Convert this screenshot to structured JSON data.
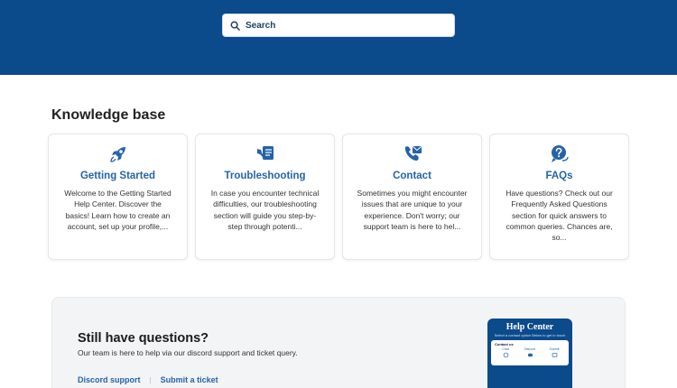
{
  "search": {
    "placeholder": "Search"
  },
  "knowledge_base": {
    "title": "Knowledge base",
    "cards": [
      {
        "icon": "rocket-icon",
        "title": "Getting Started",
        "description": "Welcome to the Getting Started Help Center. Discover the basics! Learn how to create an account, set up your profile,..."
      },
      {
        "icon": "tools-icon",
        "title": "Troubleshooting",
        "description": "In case you encounter technical difficulties, our troubleshooting section will guide you step-by-step through potenti..."
      },
      {
        "icon": "phone-mail-icon",
        "title": "Contact",
        "description": "Sometimes you might encounter issues that are unique to your experience. Don't worry; our support team is here to hel..."
      },
      {
        "icon": "question-chat-icon",
        "title": "FAQs",
        "description": "Have questions? Check out our Frequently Asked Questions section for quick answers to common queries. Chances are, so..."
      }
    ]
  },
  "cta": {
    "heading": "Still have questions?",
    "subtext": "Our team is here to help via our discord support and ticket query.",
    "link_discord": "Discord support",
    "separator": "|",
    "link_ticket": "Submit a ticket",
    "preview": {
      "title": "Help Center",
      "subtitle": "Select a contact option Below to get in touch",
      "panel_heading": "Contact us",
      "options": [
        "Chat",
        "Discord",
        "Submit"
      ]
    }
  },
  "colors": {
    "brand": "#0b4a8b",
    "link": "#2563a8"
  }
}
